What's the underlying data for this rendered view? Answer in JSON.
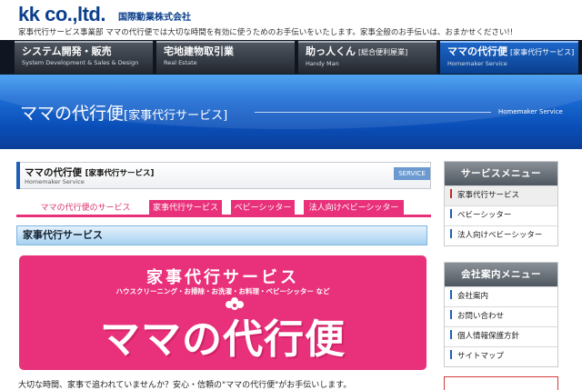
{
  "header": {
    "logo": "kk co.,ltd.",
    "company": "国際動業株式会社",
    "tagline": "家事代行サービス事業部 ママの代行便では大切な時間を有効に使うためのお手伝いをいたします。家事全般のお手伝いは、おまかせください!!"
  },
  "nav": [
    {
      "title": "システム開発・販売",
      "tag": "",
      "sub": "System Development & Sales & Design"
    },
    {
      "title": "宅地建物取引業",
      "tag": "",
      "sub": "Real Estate"
    },
    {
      "title": "助っ人くん",
      "tag": "[総合便利屋業]",
      "sub": "Handy Man"
    },
    {
      "title": "ママの代行便",
      "tag": "[家事代行サービス]",
      "sub": "Homemaker Service"
    }
  ],
  "banner": {
    "title": "ママの代行便",
    "tag": "[家事代行サービス]",
    "en": "Homemaker Service"
  },
  "page_head": {
    "title": "ママの代行便",
    "tag": "[家事代行サービス]",
    "en": "Homemaker Service",
    "badge": "SERVICE"
  },
  "subtabs": [
    {
      "label": "ママの代行便のサービス",
      "style": "plain"
    },
    {
      "label": "家事代行サービス",
      "style": "pill"
    },
    {
      "label": "ベビーシッター",
      "style": "pill"
    },
    {
      "label": "法人向けベビーシッター",
      "style": "pill"
    }
  ],
  "section": {
    "title": "家事代行サービス"
  },
  "promo": {
    "title": "家事代行サービス",
    "sub": "ハウスクリーニング・お掃除・お洗濯・お料理・ベビーシッター など",
    "brand": "ママの代行便",
    "color": "#e8317a"
  },
  "intro": "大切な時間、家事で追われていませんか？安心・信頼の\"ママの代行便\"がお手伝いします。",
  "sidebar": {
    "service_menu": {
      "title": "サービスメニュー",
      "items": [
        "家事代行サービス",
        "ベビーシッター",
        "法人向けベビーシッター"
      ]
    },
    "company_menu": {
      "title": "会社案内メニュー",
      "items": [
        "会社案内",
        "お問い合わせ",
        "個人情報保護方針",
        "サイトマップ"
      ]
    }
  },
  "colors": {
    "brand_blue": "#0b3f8c",
    "accent_pink": "#e8317a",
    "nav_dark": "#0f1622"
  }
}
